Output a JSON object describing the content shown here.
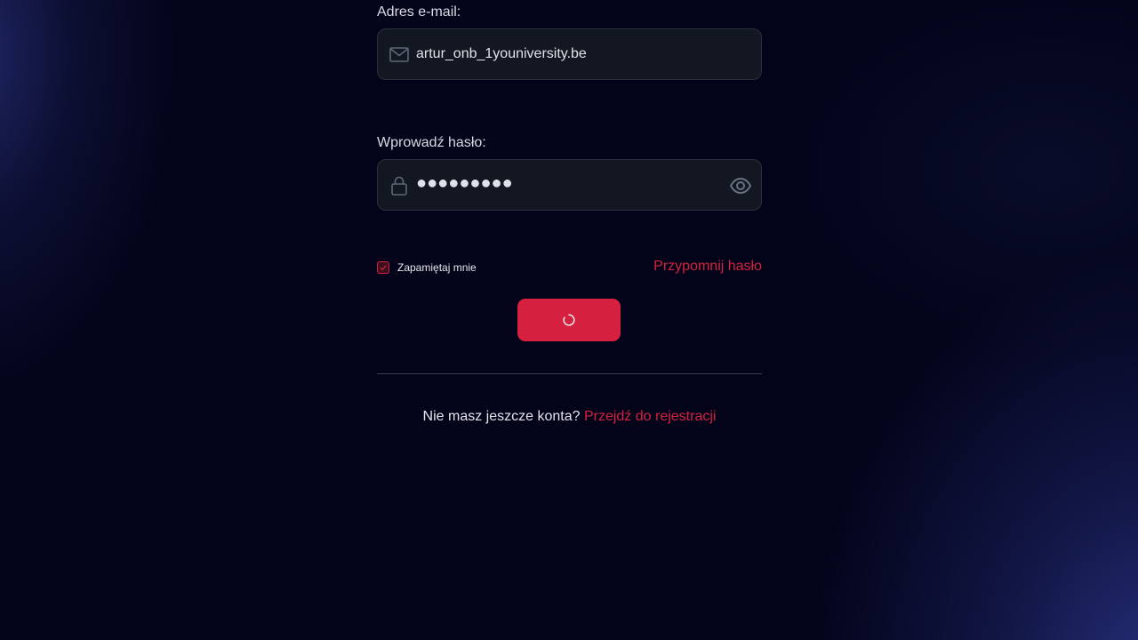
{
  "login_form": {
    "email": {
      "label": "Adres e-mail:",
      "value": "artur_onb_1youniversity.be",
      "icon": "mail-icon"
    },
    "password": {
      "label": "Wprowadź hasło:",
      "value": "●●●●●●●●●",
      "icon": "lock-icon",
      "toggle_icon": "eye-icon"
    },
    "remember_me": {
      "label": "Zapamiętaj mnie",
      "checked": true
    },
    "forgot_password_label": "Przypomnij hasło",
    "submit": {
      "state": "loading",
      "icon": "spinner-icon"
    },
    "register": {
      "prompt": "Nie masz jeszcze konta?",
      "link_label": "Przejdź do rejestracji"
    }
  },
  "colors": {
    "accent": "#d5213f",
    "background": "#03041a",
    "field_background": "#121722",
    "field_border": "#2a303d",
    "text": "#d8dbe3"
  }
}
